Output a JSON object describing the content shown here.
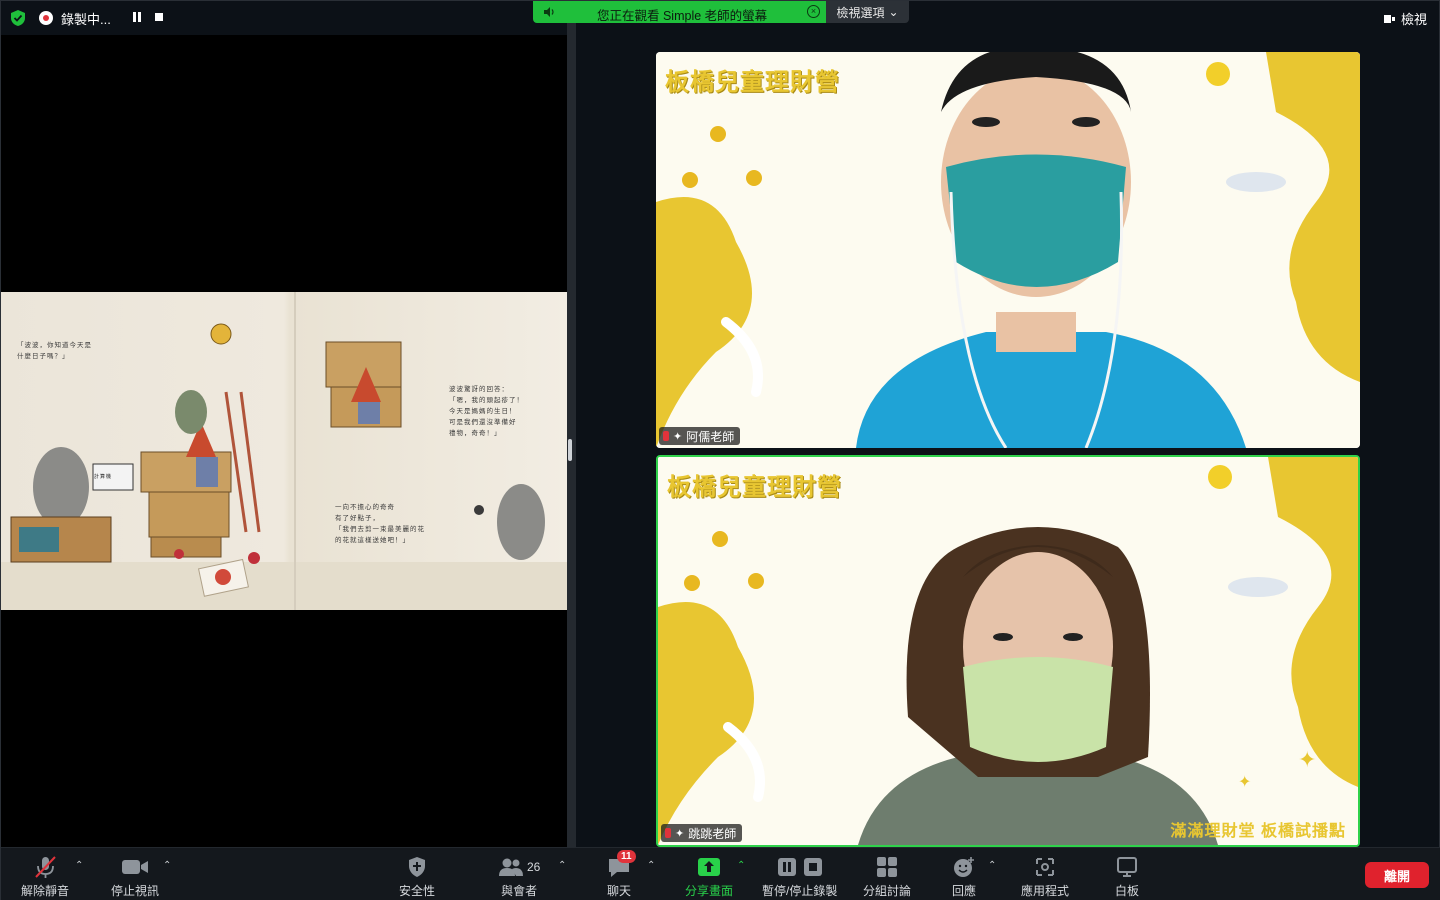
{
  "top_bar": {
    "recording_label": "錄製中...",
    "share_banner_text": "您正在觀看 Simple 老師的螢幕",
    "view_options_label": "檢視選項",
    "view_button_label": "檢視"
  },
  "shared_screen": {
    "book_left_text": "「波波，你知道今天是\n什麼日子嗎？」",
    "book_right_text_top": "波波驚訝的回答：\n「嗯，我的頭起疹了！\n今天是媽媽的生日！\n可是我們還沒準備好\n禮物，奇奇！」",
    "book_right_text_bottom": "一向不擔心的奇奇\n有了好點子，\n「我們去剪一束最美麗的花\n的花就這樣送她吧！」",
    "calculator_label": "計算機"
  },
  "participants": [
    {
      "name": "阿儒老師",
      "background_title": "板橋兒童理財營"
    },
    {
      "name": "跳跳老師",
      "background_title": "板橋兒童理財營",
      "watermark": "滿滿理財堂 板橋試播點"
    }
  ],
  "toolbar": {
    "unmute_label": "解除靜音",
    "stop_video_label": "停止視訊",
    "security_label": "安全性",
    "participants_label": "與會者",
    "participants_count": "26",
    "chat_label": "聊天",
    "chat_badge": "11",
    "share_label": "分享畫面",
    "record_label": "暫停/停止錄製",
    "breakout_label": "分組討論",
    "reactions_label": "回應",
    "apps_label": "應用程式",
    "whiteboard_label": "白板",
    "leave_label": "離開"
  },
  "colors": {
    "accent_green": "#1fbf3b",
    "leave_red": "#e0222d",
    "background_yellow": "#e8c631"
  }
}
